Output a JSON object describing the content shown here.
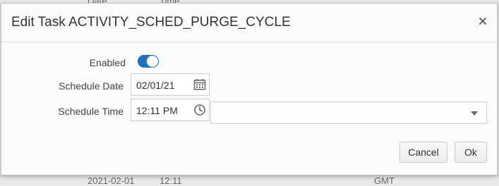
{
  "background": {
    "header_cells": [
      "Date",
      "Time"
    ],
    "row_cells": [
      "2021-02-01",
      "12:11",
      "GMT"
    ]
  },
  "dialog": {
    "title": "Edit Task ACTIVITY_SCHED_PURGE_CYCLE",
    "close_glyph": "×",
    "enabled": {
      "label": "Enabled",
      "state": "on"
    },
    "schedule_date": {
      "label": "Schedule Date",
      "value": "02/01/21"
    },
    "schedule_time": {
      "label": "Schedule Time",
      "value": "12:11 PM",
      "timezone_value": ""
    },
    "buttons": {
      "cancel": "Cancel",
      "ok": "Ok"
    }
  },
  "colors": {
    "toggle_on": "#1f72b8"
  },
  "icons": [
    "close-icon",
    "calendar-icon",
    "clock-icon",
    "chevron-down-icon"
  ]
}
